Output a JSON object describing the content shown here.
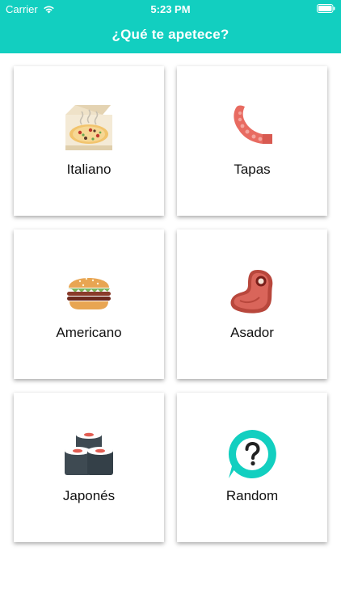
{
  "status_bar": {
    "carrier": "Carrier",
    "time": "5:23 PM"
  },
  "nav": {
    "title": "¿Qué te apetece?"
  },
  "colors": {
    "accent": "#12cfc0"
  },
  "categories": [
    {
      "label": "Italiano",
      "icon": "pizza-box-icon"
    },
    {
      "label": "Tapas",
      "icon": "octopus-tentacle-icon"
    },
    {
      "label": "Americano",
      "icon": "burger-icon"
    },
    {
      "label": "Asador",
      "icon": "steak-icon"
    },
    {
      "label": "Japonés",
      "icon": "sushi-icon"
    },
    {
      "label": "Random",
      "icon": "question-mark-icon"
    }
  ]
}
